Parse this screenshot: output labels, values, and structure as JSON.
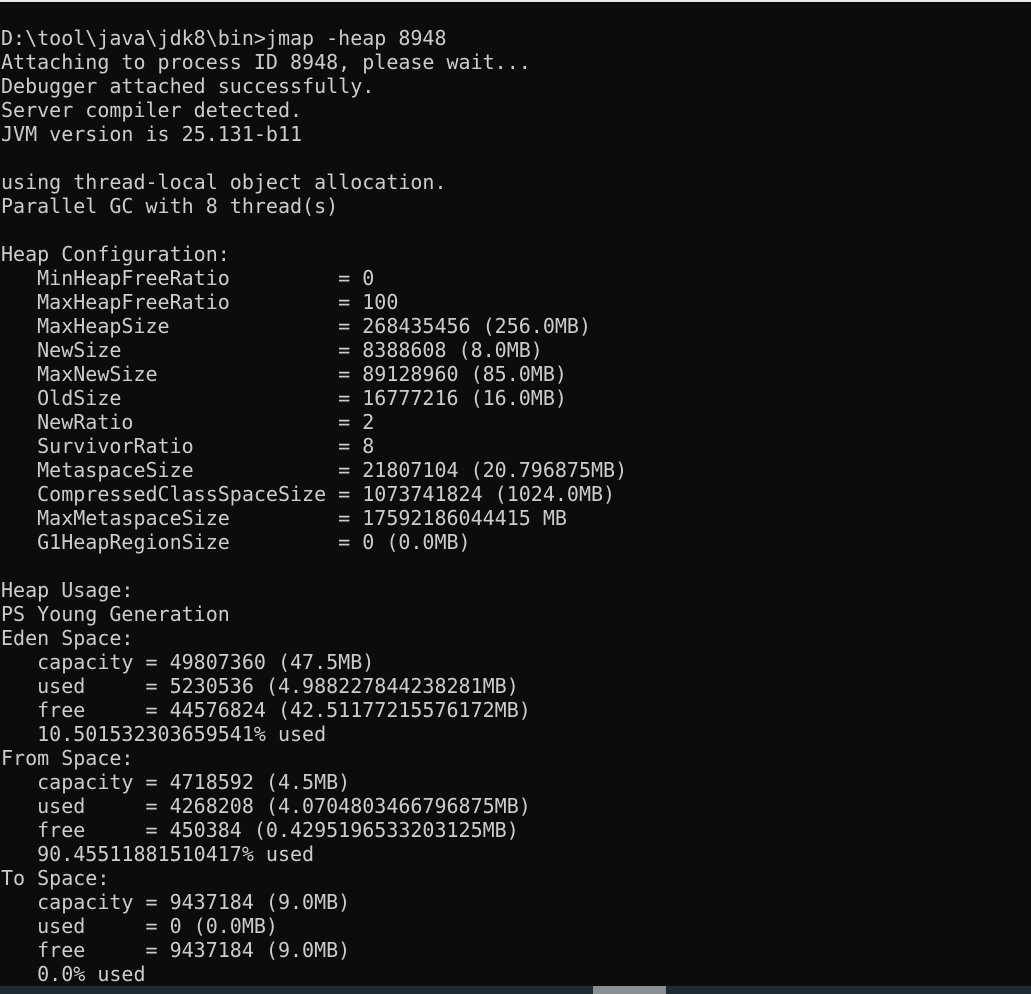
{
  "terminal": {
    "lines": [
      "D:\\tool\\java\\jdk8\\bin>jmap -heap 8948",
      "Attaching to process ID 8948, please wait...",
      "Debugger attached successfully.",
      "Server compiler detected.",
      "JVM version is 25.131-b11",
      "",
      "using thread-local object allocation.",
      "Parallel GC with 8 thread(s)",
      "",
      "Heap Configuration:",
      "   MinHeapFreeRatio         = 0",
      "   MaxHeapFreeRatio         = 100",
      "   MaxHeapSize              = 268435456 (256.0MB)",
      "   NewSize                  = 8388608 (8.0MB)",
      "   MaxNewSize               = 89128960 (85.0MB)",
      "   OldSize                  = 16777216 (16.0MB)",
      "   NewRatio                 = 2",
      "   SurvivorRatio            = 8",
      "   MetaspaceSize            = 21807104 (20.796875MB)",
      "   CompressedClassSpaceSize = 1073741824 (1024.0MB)",
      "   MaxMetaspaceSize         = 17592186044415 MB",
      "   G1HeapRegionSize         = 0 (0.0MB)",
      "",
      "Heap Usage:",
      "PS Young Generation",
      "Eden Space:",
      "   capacity = 49807360 (47.5MB)",
      "   used     = 5230536 (4.988227844238281MB)",
      "   free     = 44576824 (42.51177215576172MB)",
      "   10.501532303659541% used",
      "From Space:",
      "   capacity = 4718592 (4.5MB)",
      "   used     = 4268208 (4.0704803466796875MB)",
      "   free     = 450384 (0.4295196533203125MB)",
      "   90.45511881510417% used",
      "To Space:",
      "   capacity = 9437184 (9.0MB)",
      "   used     = 0 (0.0MB)",
      "   free     = 9437184 (9.0MB)",
      "   0.0% used"
    ]
  },
  "colors": {
    "background": "#0c0c0c",
    "foreground": "#cccccc",
    "scrollbar_track": "#1f2b33",
    "scrollbar_thumb": "#8a8f93"
  }
}
